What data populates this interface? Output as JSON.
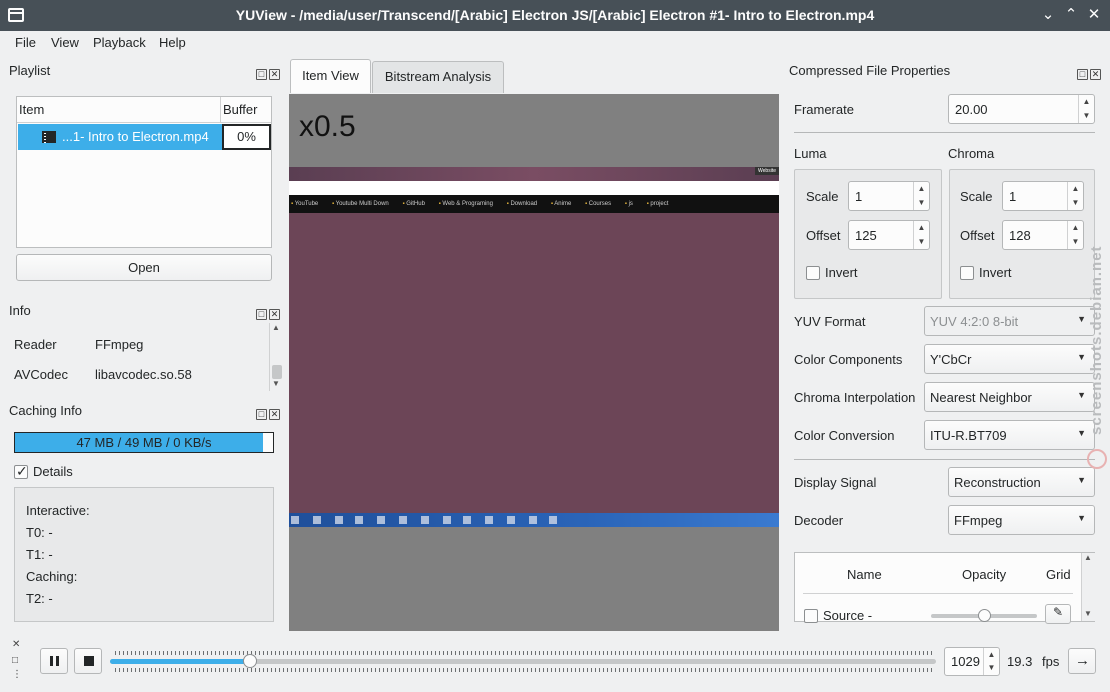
{
  "window": {
    "title": "YUView - /media/user/Transcend/[Arabic] Electron JS/[Arabic] Electron #1- Intro to Electron.mp4"
  },
  "menu": [
    "File",
    "View",
    "Playback",
    "Help"
  ],
  "playlist": {
    "title": "Playlist",
    "col_item": "Item",
    "col_buffer": "Buffer",
    "row_name": "...1- Intro to Electron.mp4",
    "row_buffer": "0%",
    "open_label": "Open"
  },
  "info": {
    "title": "Info",
    "rows": [
      {
        "label": "Reader",
        "value": "FFmpeg"
      },
      {
        "label": "AVCodec",
        "value": "libavcodec.so.58"
      }
    ]
  },
  "caching": {
    "title": "Caching Info",
    "bar_text": "47 MB / 49 MB / 0 KB/s",
    "fill_fraction": 0.96,
    "details_label": "Details",
    "details_checked": true,
    "lines": [
      "Interactive:",
      "T0: -",
      "T1: -",
      "Caching:",
      "T2: -"
    ]
  },
  "tabs": [
    "Item View",
    "Bitstream Analysis"
  ],
  "viewer": {
    "zoom": "x0.5",
    "bookmarks": [
      "YouTube",
      "Youtube Multi Down",
      "GitHub",
      "Web & Programing",
      "Download",
      "Anime",
      "Courses",
      "js",
      "project"
    ],
    "button_text": "Website"
  },
  "props": {
    "title": "Compressed File Properties",
    "framerate_label": "Framerate",
    "framerate_value": "20.00",
    "luma_label": "Luma",
    "chroma_label": "Chroma",
    "scale_label": "Scale",
    "offset_label": "Offset",
    "invert_label": "Invert",
    "luma_scale": "1",
    "luma_offset": "125",
    "chroma_scale": "1",
    "chroma_offset": "128",
    "yuv_format_label": "YUV Format",
    "yuv_format_value": "YUV 4:2:0 8-bit",
    "color_components_label": "Color Components",
    "color_components_value": "Y'CbCr",
    "chroma_interp_label": "Chroma Interpolation",
    "chroma_interp_value": "Nearest Neighbor",
    "color_conversion_label": "Color Conversion",
    "color_conversion_value": "ITU-R.BT709",
    "display_signal_label": "Display Signal",
    "display_signal_value": "Reconstruction",
    "decoder_label": "Decoder",
    "decoder_value": "FFmpeg",
    "table_cols": [
      "Name",
      "Opacity",
      "Grid"
    ],
    "table_row_name": "Source -",
    "opacity_fraction": 0.5
  },
  "playback": {
    "frame": "1029",
    "fps_value": "19.3",
    "fps_unit": "fps",
    "progress_fraction": 0.17
  },
  "watermark": "screenshots.debian.net",
  "colors": {
    "accent": "#3daee9",
    "titlebar": "#475057",
    "frame_bg": "#6c4557"
  }
}
